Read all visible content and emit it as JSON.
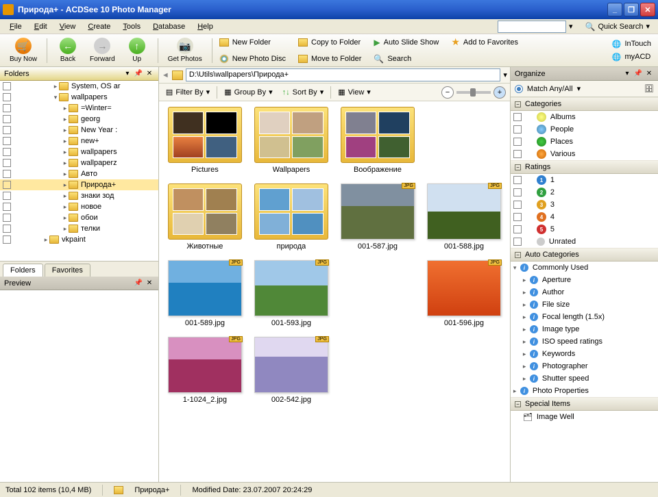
{
  "window": {
    "title": "Природа+ - ACDSee 10 Photo Manager"
  },
  "menubar": {
    "file": "File",
    "edit": "Edit",
    "view": "View",
    "create": "Create",
    "tools": "Tools",
    "database": "Database",
    "help": "Help",
    "quicksearch": "Quick Search"
  },
  "toolbar": {
    "buynow": "Buy Now",
    "back": "Back",
    "forward": "Forward",
    "up": "Up",
    "getphotos": "Get Photos",
    "newfolder": "New Folder",
    "newphotodisc": "New Photo Disc",
    "copytofolder": "Copy to Folder",
    "movetofolder": "Move to Folder",
    "autoslideshow": "Auto Slide Show",
    "search": "Search",
    "addtofavorites": "Add to Favorites",
    "intouch": "InTouch",
    "myacd": "myACD"
  },
  "panels": {
    "folders": "Folders",
    "preview": "Preview",
    "organize": "Organize"
  },
  "tabs": {
    "folders": "Folders",
    "favorites": "Favorites"
  },
  "tree": {
    "items": [
      {
        "label": "System, OS ar",
        "indent": 4
      },
      {
        "label": "wallpapers",
        "indent": 4,
        "expanded": true
      },
      {
        "label": "=Winter=",
        "indent": 5
      },
      {
        "label": "georg",
        "indent": 5
      },
      {
        "label": "New Year :",
        "indent": 5
      },
      {
        "label": "new+",
        "indent": 5
      },
      {
        "label": "wallpapers",
        "indent": 5
      },
      {
        "label": "wallpaperz",
        "indent": 5
      },
      {
        "label": "Авто",
        "indent": 5
      },
      {
        "label": "Природа+",
        "indent": 5,
        "selected": true
      },
      {
        "label": "знаки зод",
        "indent": 5
      },
      {
        "label": "новое",
        "indent": 5
      },
      {
        "label": "обои",
        "indent": 5
      },
      {
        "label": "телки",
        "indent": 5
      },
      {
        "label": "vkpaint",
        "indent": 3
      }
    ]
  },
  "addressbar": {
    "path": "D:\\Utils\\wallpapers\\Природа+"
  },
  "filterbar": {
    "filterby": "Filter By",
    "groupby": "Group By",
    "sortby": "Sort By",
    "view": "View"
  },
  "thumbs": {
    "items": [
      {
        "label": "Pictures",
        "type": "folder",
        "cls": "tf1"
      },
      {
        "label": "Wallpapers",
        "type": "folder",
        "cls": "tf2"
      },
      {
        "label": "Воображение",
        "type": "folder",
        "cls": "tf3"
      },
      {
        "label": "Животные",
        "type": "folder",
        "cls": "tf4"
      },
      {
        "label": "природа",
        "type": "folder",
        "cls": "tf5"
      },
      {
        "label": "001-587.jpg",
        "type": "jpg",
        "cls": "ti6"
      },
      {
        "label": "001-588.jpg",
        "type": "jpg",
        "cls": "ti7"
      },
      {
        "label": "001-589.jpg",
        "type": "jpg",
        "cls": "ti8"
      },
      {
        "label": "001-593.jpg",
        "type": "jpg",
        "cls": "ti9"
      },
      {
        "label": "001-596.jpg",
        "type": "jpg",
        "cls": "ti10"
      },
      {
        "label": "1-1024_2.jpg",
        "type": "jpg",
        "cls": "ti11"
      },
      {
        "label": "002-542.jpg",
        "type": "jpg",
        "cls": "ti12"
      }
    ]
  },
  "organize": {
    "matchlabel": "Match Any/All",
    "categories_hdr": "Categories",
    "categories": [
      {
        "label": "Albums",
        "icon": "icon-albums"
      },
      {
        "label": "People",
        "icon": "icon-people"
      },
      {
        "label": "Places",
        "icon": "icon-places"
      },
      {
        "label": "Various",
        "icon": "icon-various"
      }
    ],
    "ratings_hdr": "Ratings",
    "ratings": [
      {
        "label": "1",
        "cls": "r1"
      },
      {
        "label": "2",
        "cls": "r2"
      },
      {
        "label": "3",
        "cls": "r3"
      },
      {
        "label": "4",
        "cls": "r4"
      },
      {
        "label": "5",
        "cls": "r5"
      }
    ],
    "unrated": "Unrated",
    "autocat_hdr": "Auto Categories",
    "commonly_used": "Commonly Used",
    "auto_items": [
      "Aperture",
      "Author",
      "File size",
      "Focal length (1.5x)",
      "Image type",
      "ISO speed ratings",
      "Keywords",
      "Photographer",
      "Shutter speed"
    ],
    "photo_properties": "Photo Properties",
    "special_hdr": "Special Items",
    "image_well": "Image Well"
  },
  "statusbar": {
    "total": "Total 102 items  (10,4 MB)",
    "folder": "Природа+",
    "modified": "Modified Date: 23.07.2007 20:24:29"
  }
}
